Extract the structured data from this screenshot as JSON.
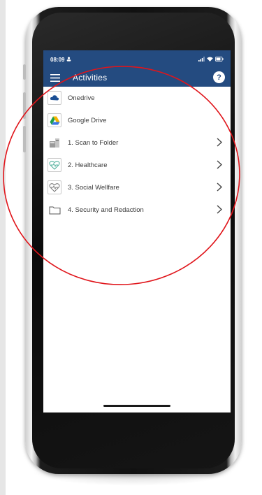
{
  "status": {
    "time": "08:09"
  },
  "header": {
    "title": "Activities",
    "help_label": "?"
  },
  "activities": [
    {
      "label": "Onedrive",
      "icon": "onedrive-icon",
      "chevron": false
    },
    {
      "label": "Google Drive",
      "icon": "google-drive-icon",
      "chevron": false
    },
    {
      "label": "1. Scan to Folder",
      "icon": "scanner-icon",
      "chevron": true
    },
    {
      "label": "2. Healthcare",
      "icon": "healthcare-icon",
      "chevron": true
    },
    {
      "label": "3. Social Wellfare",
      "icon": "social-welfare-icon",
      "chevron": true
    },
    {
      "label": "4. Security and Redaction",
      "icon": "folder-icon",
      "chevron": true
    }
  ],
  "colors": {
    "header": "#244b80",
    "annotation": "#e0151b"
  }
}
